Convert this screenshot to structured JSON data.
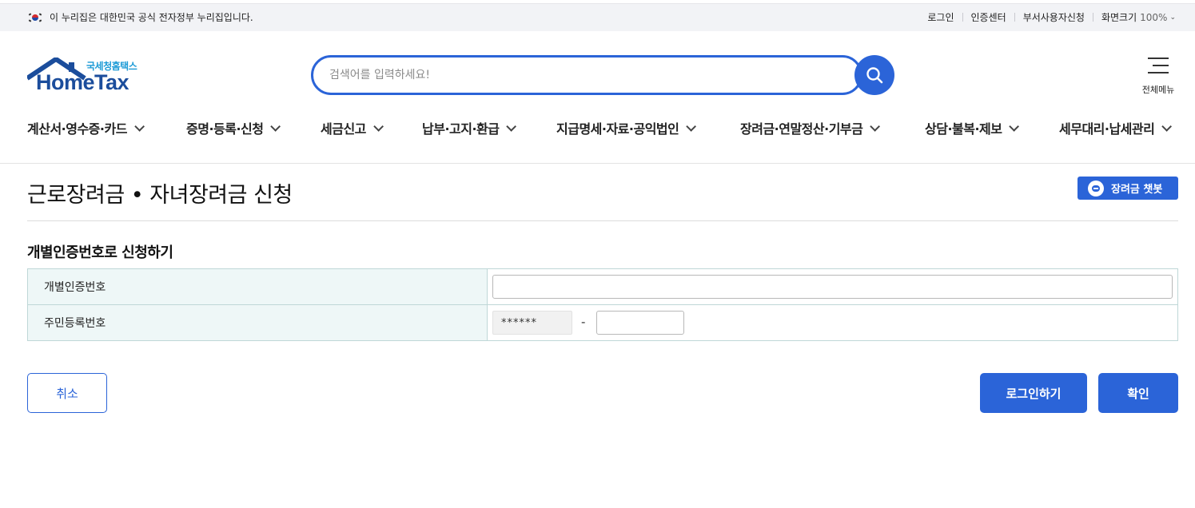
{
  "topbar": {
    "gov_notice": "이 누리집은 대한민국 공식 전자정부 누리집입니다.",
    "links": [
      "로그인",
      "인증센터",
      "부서사용자신청",
      "화면크기"
    ],
    "zoom": "100%"
  },
  "header": {
    "logo_ko": "국세청홈택스",
    "logo_en": "HomeTax",
    "search_placeholder": "검색어를 입력하세요!",
    "menu_label": "전체메뉴"
  },
  "gnb": [
    "계산서·영수증·카드",
    "증명·등록·신청",
    "세금신고",
    "납부·고지·환급",
    "지급명세·자료·공익법인",
    "장려금·연말정산·기부금",
    "상담·불복·제보",
    "세무대리·납세관리"
  ],
  "page": {
    "title": "근로장려금 • 자녀장려금 신청",
    "chatbot": "장려금 챗봇",
    "section_title": "개별인증번호로 신청하기"
  },
  "form": {
    "cert_label": "개별인증번호",
    "rrn_label": "주민등록번호",
    "rrn_front_masked": "******",
    "rrn_dash": "-"
  },
  "buttons": {
    "cancel": "취소",
    "login": "로그인하기",
    "confirm": "확인"
  },
  "colors": {
    "primary": "#2b64d8",
    "table_header_bg": "#eef7f7",
    "logo_blue": "#1b4d9c",
    "logo_cyan": "#1b9ad6"
  }
}
